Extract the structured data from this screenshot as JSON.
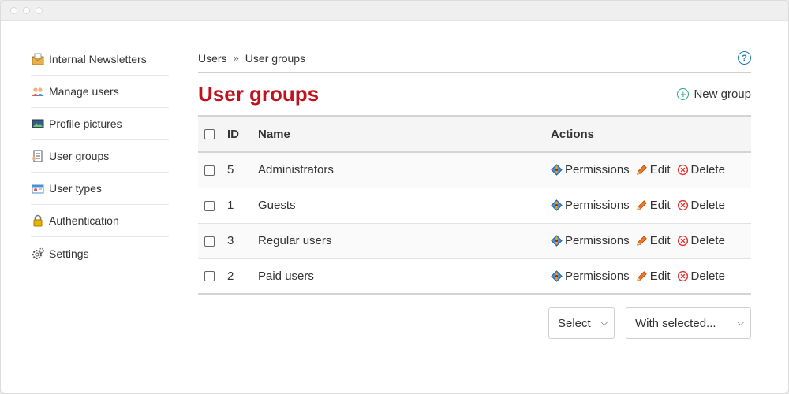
{
  "sidebar": {
    "items": [
      {
        "label": "Internal Newsletters",
        "icon": "newsletter-icon"
      },
      {
        "label": "Manage users",
        "icon": "users-icon"
      },
      {
        "label": "Profile pictures",
        "icon": "picture-icon"
      },
      {
        "label": "User groups",
        "icon": "groups-icon"
      },
      {
        "label": "User types",
        "icon": "id-card-icon"
      },
      {
        "label": "Authentication",
        "icon": "lock-icon"
      },
      {
        "label": "Settings",
        "icon": "gear-icon"
      }
    ]
  },
  "breadcrumb": {
    "root": "Users",
    "separator": "»",
    "current": "User groups"
  },
  "page": {
    "title": "User groups",
    "new_group_label": "New group"
  },
  "table": {
    "headers": {
      "id": "ID",
      "name": "Name",
      "actions": "Actions"
    },
    "rows": [
      {
        "id": "5",
        "name": "Administrators"
      },
      {
        "id": "1",
        "name": "Guests"
      },
      {
        "id": "3",
        "name": "Regular users"
      },
      {
        "id": "2",
        "name": "Paid users"
      }
    ],
    "action_labels": {
      "permissions": "Permissions",
      "edit": "Edit",
      "delete": "Delete"
    }
  },
  "bulk": {
    "select_value": "Select",
    "with_selected_value": "With selected..."
  },
  "colors": {
    "title": "#c0111c",
    "accent_green": "#2aa585",
    "help_blue": "#1a78b8",
    "delete_red": "#e0322f"
  }
}
